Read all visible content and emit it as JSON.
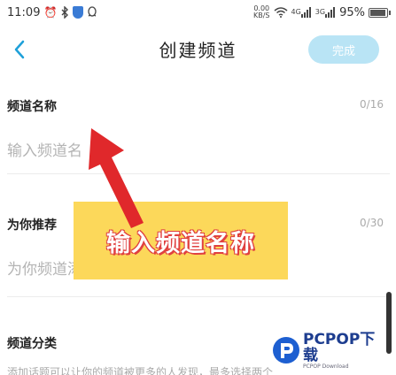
{
  "status_bar": {
    "time": "11:09",
    "speed_value": "0.00",
    "speed_unit": "KB/S",
    "net1": "4G",
    "net2": "3G",
    "battery_text": "95%",
    "battery_level": 0.95
  },
  "nav": {
    "title": "创建频道",
    "done_label": "完成"
  },
  "form": {
    "name_label": "频道名称",
    "name_count": "0/16",
    "name_placeholder": "输入频道名",
    "recommend_label": "为你推荐",
    "recommend_count": "0/30",
    "recommend_placeholder": "为你频道添",
    "category_label": "频道分类",
    "category_hint": "添加话题可以让你的频道被更多的人发现，最多选择两个"
  },
  "annotation": {
    "text": "输入频道名称"
  },
  "watermark": {
    "main": "PCPOP下载",
    "sub": "PCPOP Download"
  },
  "colors": {
    "accent": "#1ea0d9",
    "done_disabled": "#b9e4f5",
    "annotation_bg": "#fcd85a",
    "arrow": "#e0282b"
  }
}
